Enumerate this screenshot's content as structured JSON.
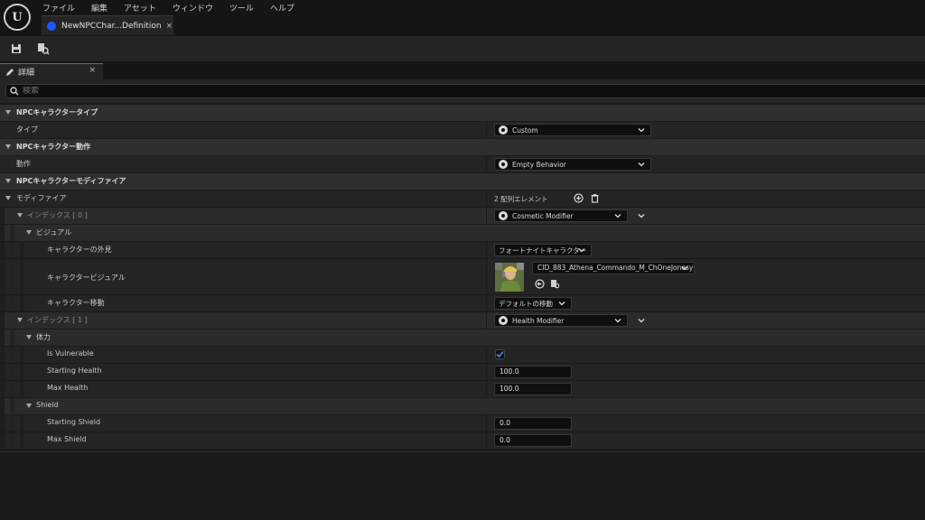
{
  "menu": [
    "ファイル",
    "編集",
    "アセット",
    "ウィンドウ",
    "ツール",
    "ヘルプ"
  ],
  "document_tab": {
    "label": "NewNPCChar...Definition",
    "close": "×"
  },
  "details_tab": {
    "label": "詳細",
    "close": "×"
  },
  "search": {
    "placeholder": "検索"
  },
  "categories": {
    "type": {
      "label": "NPCキャラクタータイプ",
      "prop_label": "タイプ",
      "value": "Custom"
    },
    "behavior": {
      "label": "NPCキャラクター動作",
      "prop_label": "動作",
      "value": "Empty Behavior"
    },
    "modifiers": {
      "label": "NPCキャラクターモディファイア",
      "prop_label": "モディファイア",
      "count": "2 配列エレメント"
    }
  },
  "index0": {
    "label": "インデックス [ 0 ]",
    "value": "Cosmetic Modifier",
    "visual": {
      "label": "ビジュアル",
      "appearance_label": "キャラクターの外見",
      "appearance_value": "フォートナイトキャラクター",
      "visual_label": "キャラクタービジュアル",
      "visual_value": "CID_883_Athena_Commando_M_ChOneJonesy",
      "movement_label": "キャラクター移動",
      "movement_value": "デフォルトの移動"
    }
  },
  "index1": {
    "label": "インデックス [ 1 ]",
    "value": "Health Modifier",
    "health": {
      "label": "体力",
      "vulnerable_label": "Is Vulnerable",
      "vulnerable": true,
      "starting_health_label": "Starting Health",
      "starting_health": "100.0",
      "max_health_label": "Max Health",
      "max_health": "100.0"
    },
    "shield": {
      "label": "Shield",
      "starting_shield_label": "Starting Shield",
      "starting_shield": "0.0",
      "max_shield_label": "Max Shield",
      "max_shield": "0.0"
    }
  },
  "colors": {
    "accent": "#1f56ff",
    "check": "#3d8de8"
  }
}
